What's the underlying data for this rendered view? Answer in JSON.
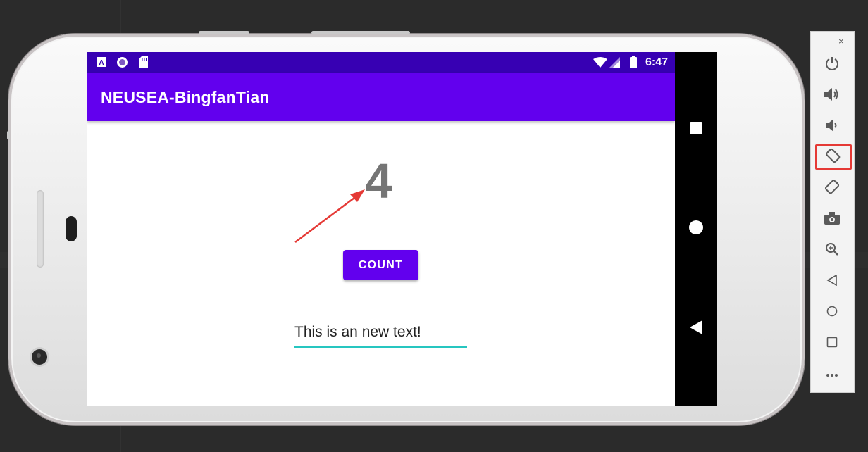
{
  "status_bar": {
    "time": "6:47"
  },
  "app_bar": {
    "title": "NEUSEA-BingfanTian"
  },
  "main": {
    "count_value": "4",
    "count_button_label": "COUNT",
    "text_field_value": "This is an new text!"
  },
  "colors": {
    "primary": "#6200ee",
    "primary_dark": "#3700b3",
    "counter_text": "#757575",
    "text_field_underline": "#26c6c0",
    "annotation": "#e53935"
  },
  "nav_bar": {
    "icons": [
      "recent-apps-icon",
      "home-icon",
      "back-icon"
    ]
  },
  "emulator_toolbar": {
    "window_controls": [
      "minimize",
      "close"
    ],
    "buttons": [
      "power-icon",
      "volume-up-icon",
      "volume-down-icon",
      "rotate-left-icon",
      "rotate-right-icon",
      "screenshot-icon",
      "zoom-icon",
      "back-icon",
      "home-icon",
      "overview-icon",
      "more-icon"
    ],
    "selected": "rotate-left-icon"
  }
}
